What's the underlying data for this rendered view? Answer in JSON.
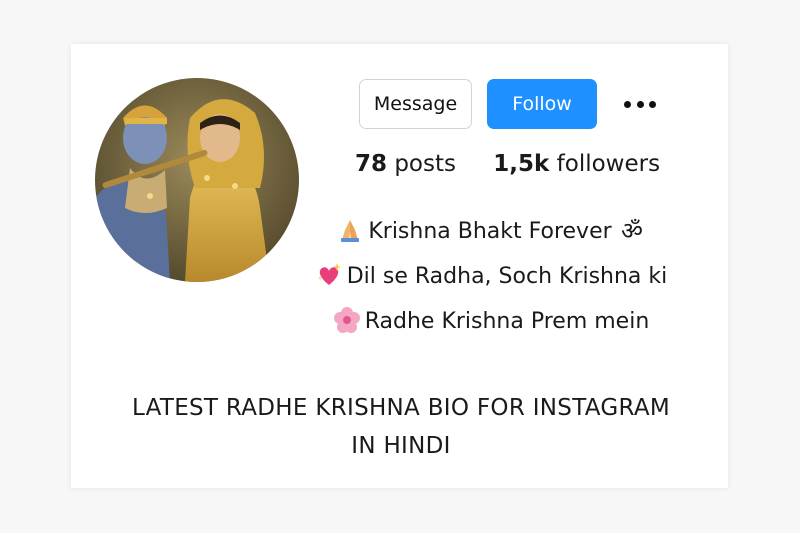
{
  "profile": {
    "avatar_alt": "Radha Krishna portrait"
  },
  "actions": {
    "message_label": "Message",
    "follow_label": "Follow",
    "more_icon": "more-horizontal-icon"
  },
  "stats": {
    "posts_count": "78",
    "posts_label": "posts",
    "followers_count": "1,5k",
    "followers_label": "followers"
  },
  "bio": {
    "line1": "Krishna Bhakt Forever",
    "line1_emoji_before": "folded-hands-icon",
    "line1_emoji_after": "om-icon",
    "line2": "Dil se Radha, Soch Krishna ki",
    "line2_emoji": "sparkling-heart-icon",
    "line3": "Radhe Krishna Prem mein",
    "line3_emoji": "cherry-blossom-icon"
  },
  "caption": {
    "line1": "LATEST RADHE KRISHNA BIO FOR INSTAGRAM",
    "line2": "IN HINDI"
  },
  "colors": {
    "follow_button": "#1e90ff",
    "background": "#f7f7f7",
    "card": "#ffffff"
  }
}
